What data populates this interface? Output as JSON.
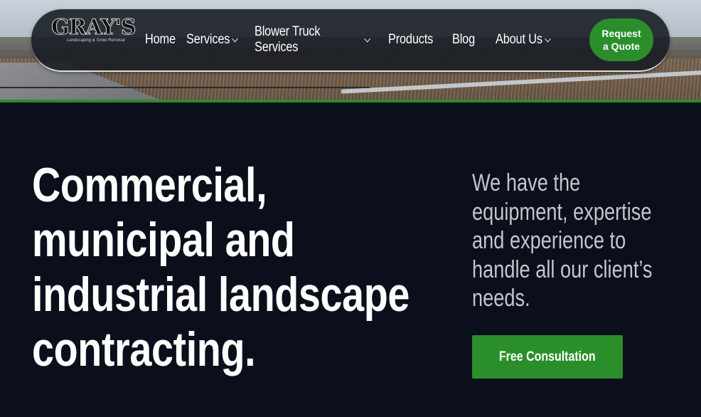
{
  "nav": {
    "logo_text": "GRAY'S",
    "logo_tagline": "Landscaping & Snow Removal",
    "items": [
      {
        "label": "Home",
        "has_dropdown": false
      },
      {
        "label": "Services",
        "has_dropdown": true
      },
      {
        "label": "Blower Truck Services",
        "has_dropdown": true
      },
      {
        "label": "Products",
        "has_dropdown": false
      },
      {
        "label": "Blog",
        "has_dropdown": false
      },
      {
        "label": "About Us",
        "has_dropdown": true
      }
    ],
    "quote_button": {
      "line1": "Request",
      "line2": "a Quote"
    }
  },
  "hero": {
    "headline": "Commercial, municipal and industrial landscape contracting.",
    "subtext": "We have the equipment, expertise and experience to handle all our client’s needs.",
    "cta_label": "Free Consultation"
  },
  "colors": {
    "accent_green": "#2a8f2a",
    "background": "#0a0f1b",
    "subtext": "#c2c6cc"
  }
}
